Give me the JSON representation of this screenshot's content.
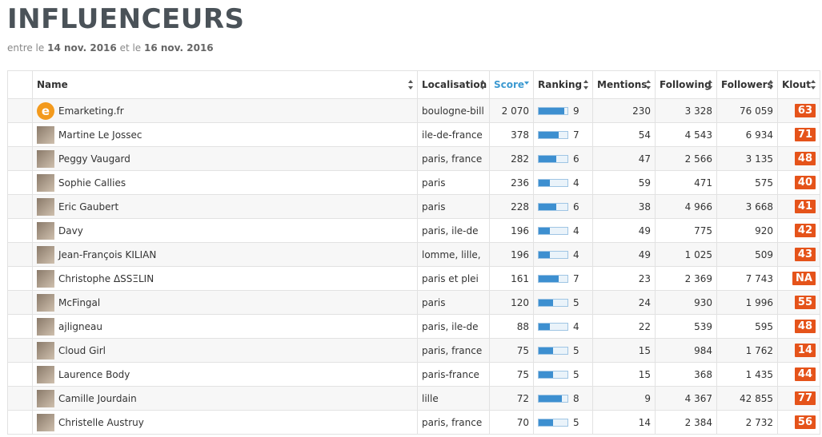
{
  "title": "INFLUENCEURS",
  "subtitle": {
    "prefix": "entre le ",
    "from": "14 nov. 2016",
    "middle": " et le ",
    "to": "16 nov. 2016"
  },
  "columns": [
    "Name",
    "Localisation",
    "Score",
    "Ranking",
    "Mentions",
    "Following",
    "Followers",
    "Klout"
  ],
  "colors": {
    "accent": "#3d9ad1",
    "klout": "#e5531a",
    "bar": "#3d8fd0"
  },
  "rows": [
    {
      "name": "Emarketing.fr",
      "loc": "boulogne-bill",
      "score": "2 070",
      "rank": 9,
      "mentions": "230",
      "following": "3 328",
      "followers": "76 059",
      "klout": "63",
      "logo": "e"
    },
    {
      "name": "Martine Le Jossec",
      "loc": "ile-de-france",
      "score": "378",
      "rank": 7,
      "mentions": "54",
      "following": "4 543",
      "followers": "6 934",
      "klout": "71"
    },
    {
      "name": "Peggy Vaugard",
      "loc": "paris, france",
      "score": "282",
      "rank": 6,
      "mentions": "47",
      "following": "2 566",
      "followers": "3 135",
      "klout": "48"
    },
    {
      "name": "Sophie Callies",
      "loc": "paris",
      "score": "236",
      "rank": 4,
      "mentions": "59",
      "following": "471",
      "followers": "575",
      "klout": "40"
    },
    {
      "name": "Eric Gaubert",
      "loc": "paris",
      "score": "228",
      "rank": 6,
      "mentions": "38",
      "following": "4 966",
      "followers": "3 668",
      "klout": "41"
    },
    {
      "name": "Davy",
      "loc": "paris, ile-de",
      "score": "196",
      "rank": 4,
      "mentions": "49",
      "following": "775",
      "followers": "920",
      "klout": "42"
    },
    {
      "name": "Jean-François KILIAN",
      "loc": "lomme, lille,",
      "score": "196",
      "rank": 4,
      "mentions": "49",
      "following": "1 025",
      "followers": "509",
      "klout": "43"
    },
    {
      "name": "Christophe ΔSSΞLIN",
      "loc": "paris et plei",
      "score": "161",
      "rank": 7,
      "mentions": "23",
      "following": "2 369",
      "followers": "7 743",
      "klout": "NA"
    },
    {
      "name": "McFingal",
      "loc": "paris",
      "score": "120",
      "rank": 5,
      "mentions": "24",
      "following": "930",
      "followers": "1 996",
      "klout": "55"
    },
    {
      "name": "ajligneau",
      "loc": "paris, ile-de",
      "score": "88",
      "rank": 4,
      "mentions": "22",
      "following": "539",
      "followers": "595",
      "klout": "48"
    },
    {
      "name": "Cloud Girl",
      "loc": "paris, france",
      "score": "75",
      "rank": 5,
      "mentions": "15",
      "following": "984",
      "followers": "1 762",
      "klout": "14"
    },
    {
      "name": "Laurence Body",
      "loc": "paris-france",
      "score": "75",
      "rank": 5,
      "mentions": "15",
      "following": "368",
      "followers": "1 435",
      "klout": "44"
    },
    {
      "name": "Camille Jourdain",
      "loc": "lille",
      "score": "72",
      "rank": 8,
      "mentions": "9",
      "following": "4 367",
      "followers": "42 855",
      "klout": "77"
    },
    {
      "name": "Christelle Austruy",
      "loc": "paris, france",
      "score": "70",
      "rank": 5,
      "mentions": "14",
      "following": "2 384",
      "followers": "2 732",
      "klout": "56"
    }
  ]
}
